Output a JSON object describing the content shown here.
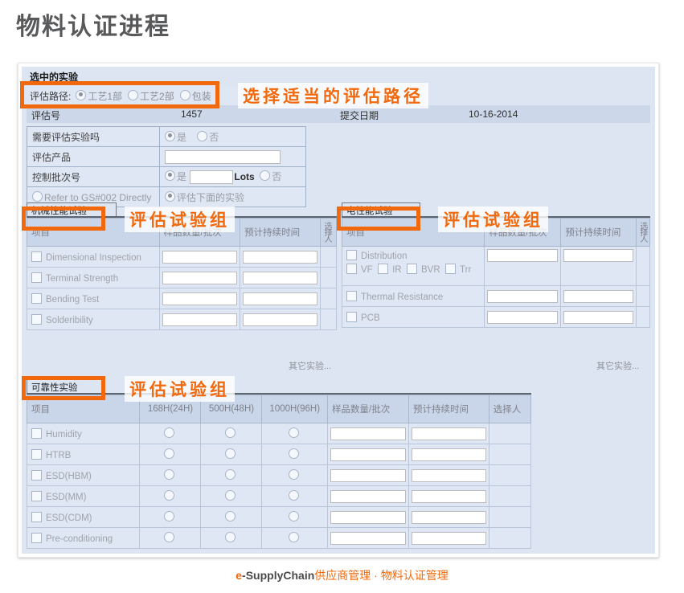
{
  "page_title": "物料认证进程",
  "panel": {
    "section_caption": "选中的实验",
    "eval_path": {
      "label": "评估路径:",
      "options": [
        {
          "label": "工艺1部",
          "selected": true
        },
        {
          "label": "工艺2部",
          "selected": false
        },
        {
          "label": "包装",
          "selected": false
        }
      ]
    },
    "meta": {
      "eval_no_label": "评估号",
      "eval_no_value": "1457",
      "submit_date_label": "提交日期",
      "submit_date_value": "10-16-2014"
    },
    "form_rows": [
      {
        "label": "需要评估实验吗",
        "type": "yes-no",
        "yes": "是",
        "no": "否",
        "selected": "yes"
      },
      {
        "label": "评估产品",
        "type": "text",
        "value": ""
      },
      {
        "label": "控制批次号",
        "type": "lots",
        "yes": "是",
        "lots_value": "",
        "lots_unit": "Lots",
        "no": "否",
        "selected": "yes"
      },
      {
        "label": "Refer to GS#002 Directly",
        "type": "refer",
        "left_selected": false,
        "right_label": "评估下面的实验",
        "right_selected": true
      }
    ]
  },
  "mechanical_group": {
    "tab_label": "机械性能试验",
    "columns": [
      "项目",
      "样品数量/批次",
      "预计持续时间",
      "选择人"
    ],
    "rows": [
      {
        "label": "Dimensional Inspection",
        "qty": "",
        "duration": ""
      },
      {
        "label": "Terminal Strength",
        "qty": "",
        "duration": ""
      },
      {
        "label": "Bending Test",
        "qty": "",
        "duration": ""
      },
      {
        "label": "Solderibility",
        "qty": "",
        "duration": ""
      }
    ],
    "more_label": "其它实验..."
  },
  "electrical_group": {
    "tab_label": "电性能试验",
    "columns": [
      "项目",
      "样品数量/批次",
      "预计持续时间",
      "选择人"
    ],
    "rows": [
      {
        "label": "Distribution",
        "qty": "",
        "duration": ""
      },
      {
        "label": "Thermal Resistance",
        "qty": "",
        "duration": ""
      },
      {
        "label": "PCB",
        "qty": "",
        "duration": ""
      }
    ],
    "sub_options": [
      "VF",
      "IR",
      "BVR",
      "Trr"
    ],
    "more_label": "其它实验..."
  },
  "reliability_group": {
    "tab_label": "可靠性实验",
    "columns": [
      "项目",
      "168H(24H)",
      "500H(48H)",
      "1000H(96H)",
      "样品数量/批次",
      "预计持续时间",
      "选择人"
    ],
    "rows": [
      {
        "label": "Humidity",
        "qty": "",
        "duration": ""
      },
      {
        "label": "HTRB",
        "qty": "",
        "duration": ""
      },
      {
        "label": "ESD(HBM)",
        "qty": "",
        "duration": ""
      },
      {
        "label": "ESD(MM)",
        "qty": "",
        "duration": ""
      },
      {
        "label": "ESD(CDM)",
        "qty": "",
        "duration": ""
      },
      {
        "label": "Pre-conditioning",
        "qty": "",
        "duration": ""
      }
    ]
  },
  "annotations": {
    "path": "选择适当的评估路径",
    "group_mech": "评估试验组",
    "group_elec": "评估试验组",
    "group_reli": "评估试验组"
  },
  "footer": {
    "brand_e": "e",
    "brand_rest": "-SupplyChain",
    "tagline": "供应商管理 · 物料认证管理"
  },
  "colors": {
    "accent_orange": "#f2690d",
    "panel_blue": "#dde5f2",
    "table_row": "#dfe7f4",
    "table_header": "#c9d5e9",
    "meta_row": "#ccd8ea",
    "title_gray": "#58595b"
  }
}
